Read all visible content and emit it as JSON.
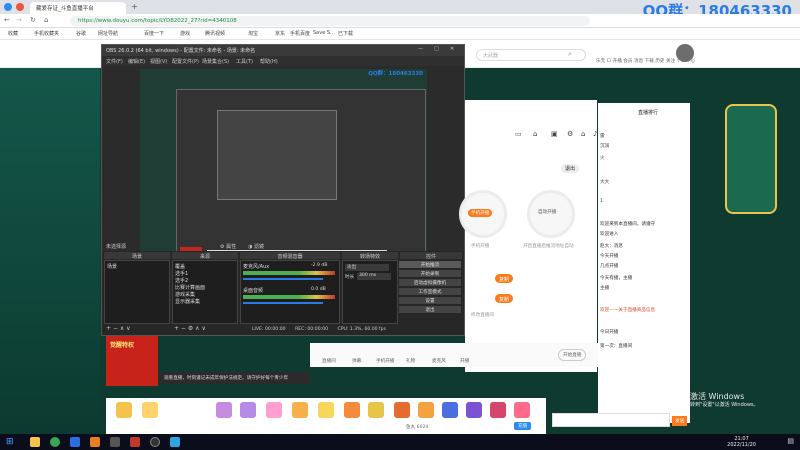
{
  "browser": {
    "tabs": [
      {
        "label": "藏爱存证_斗鱼直播平台"
      }
    ],
    "url": "https://www.douyu.com/topic/LYD82022_27?rid=4340108",
    "bookmarks": [
      "收藏",
      "手机收藏夹",
      "谷歌",
      "网址导航",
      "百度一下",
      "游戏",
      "腾讯视频",
      "淘宝",
      "京东",
      "手机百度",
      "Save S…",
      "已下载"
    ],
    "watermark": "QQ群：180463330"
  },
  "site_header": {
    "search_placeholder": "大武器",
    "nav": [
      "乐无",
      "Ci",
      "开播",
      "会员",
      "消息",
      "下载",
      "历史",
      "关注",
      "个人中心"
    ]
  },
  "obs": {
    "title": "OBS 26.0.2 (64 bit, windows) - 配置文件: 未命名 - 场景: 未命名",
    "menu": [
      "文件(F)",
      "编辑(E)",
      "视图(V)",
      "配置文件(P)",
      "场景集合(S)",
      "工具(T)",
      "帮助(H)"
    ],
    "preview_watermark": "QQ群：180463330",
    "no_source": "未选择源",
    "props_btn": "属性",
    "filter_btn": "滤镜",
    "docks": {
      "scenes": {
        "header": "场景",
        "items": [
          "场景"
        ]
      },
      "sources": {
        "header": "来源",
        "items": [
          "覆盖",
          "选手1",
          "选手2",
          "比赛计算画面",
          "游戏采集",
          "显示器采集"
        ]
      },
      "mixer": {
        "header": "音频混音器",
        "tracks": [
          {
            "name": "麦克风/Aux",
            "value": "-2.9 dB"
          },
          {
            "name": "桌面音频",
            "value": "0.0 dB"
          }
        ]
      },
      "transitions": {
        "header": "转场特效",
        "type": "淡出",
        "duration_label": "时长",
        "duration": "300 ms"
      },
      "controls": {
        "header": "控件",
        "buttons": [
          "开始推流",
          "开始录制",
          "启动虚拟摄像机",
          "工作室模式",
          "设置",
          "退出"
        ]
      }
    },
    "status": {
      "live": "LIVE: 00:00:00",
      "rec": "REC: 00:00:00",
      "cpu": "CPU: 1.3%, 60.00 fps"
    }
  },
  "panel": {
    "title": "",
    "icons": [
      "video-icon",
      "lock-icon",
      "screen-icon",
      "settings-icon",
      "home-icon",
      "bell-icon"
    ],
    "quit": "退出",
    "left_circle_label": "手机开播",
    "right_circle_label": "自动开播",
    "left_sub": "手机开播",
    "right_sub": "开启直播后推流地址自动",
    "buttons": [
      "复制",
      "复制"
    ],
    "link": "修改直播间",
    "toolbar": [
      "直播间",
      "弹幕",
      "手机开播",
      "礼物",
      "麦克风",
      "开播"
    ],
    "live_button": "开始直播"
  },
  "chat": {
    "header": "直播排行",
    "lines": [
      "欢迎来到本直播间，请遵守",
      "欢迎进入",
      "雷",
      "沉溺",
      "火",
      "大大",
      "1",
      "赵大：消息",
      "今天开播",
      "几点开播",
      "今天有播，主播",
      "主播",
      "欢迎——关于直播商品信息",
      "今日开播",
      "第一次：直播间"
    ],
    "send": "发送"
  },
  "ad": {
    "title": "觉醒特权",
    "subtitle": "",
    "notice": "观看直播，时刻谨记未成年保护法规定。请守护好每个青少年"
  },
  "gifts": {
    "count_label": "鱼丸 6024",
    "recharge": "充值"
  },
  "windows_watermark": [
    "激活 Windows",
    "转到\"设置\"以激活 Windows。"
  ],
  "taskbar": {
    "time": "21:07",
    "date": "2022/11/20"
  }
}
